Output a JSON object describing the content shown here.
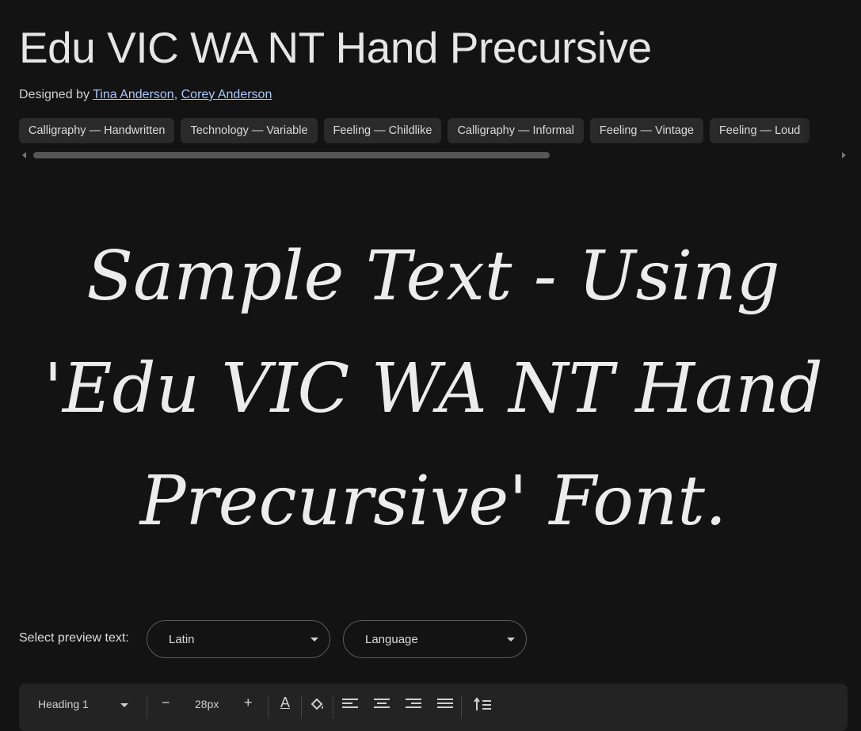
{
  "font": {
    "name": "Edu VIC WA NT Hand Precursive",
    "designed_by_label": "Designed by",
    "designers": [
      "Tina Anderson",
      "Corey Anderson"
    ]
  },
  "tags": [
    "Calligraphy — Handwritten",
    "Technology — Variable",
    "Feeling — Childlike",
    "Calligraphy — Informal",
    "Feeling — Vintage",
    "Feeling — Loud"
  ],
  "sample_text": "Sample Text - Using 'Edu VIC WA NT Hand Precursive' Font.",
  "preview": {
    "label": "Select preview text:",
    "script_select": "Latin",
    "language_select": "Language"
  },
  "toolbar": {
    "style_select": "Heading 1",
    "font_size": "28px",
    "decrease_glyph": "−",
    "increase_glyph": "+",
    "text_color_glyph": "A"
  },
  "icons": {
    "decrease": "minus-icon",
    "increase": "plus-icon",
    "text_color": "text-color-icon",
    "highlight": "paint-bucket-icon",
    "align_left": "align-left-icon",
    "align_center": "align-center-icon",
    "align_right": "align-right-icon",
    "justify": "align-justify-icon",
    "line_height": "line-height-icon"
  }
}
